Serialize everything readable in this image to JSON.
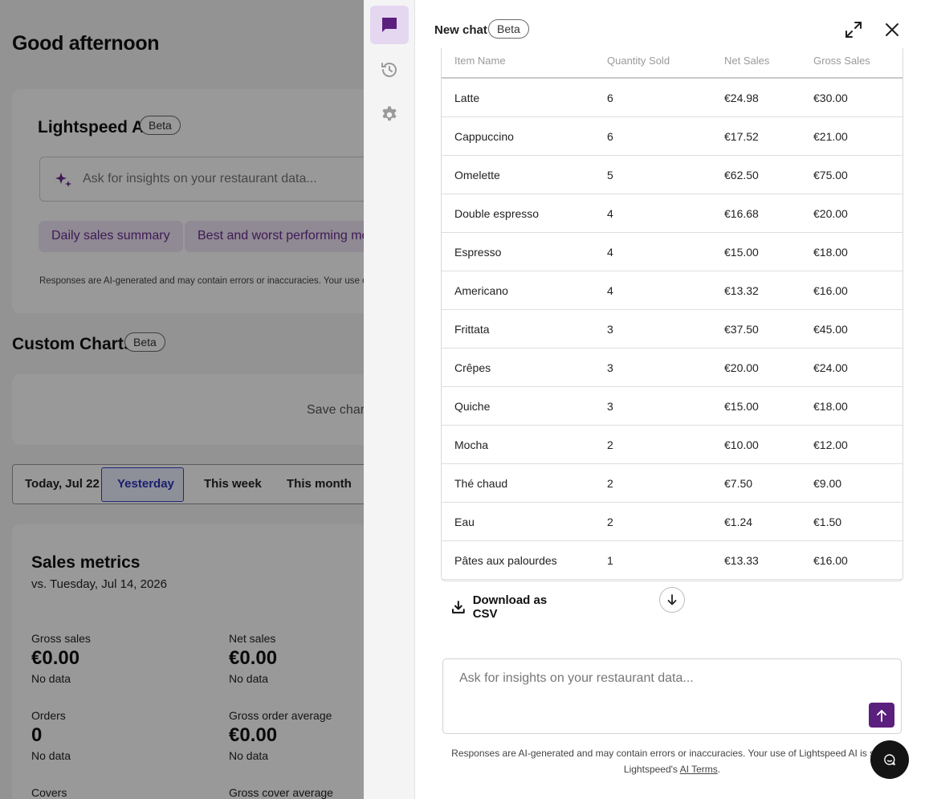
{
  "background": {
    "greeting": "Good afternoon",
    "ai_card": {
      "title": "Lightspeed AI",
      "badge": "Beta",
      "input_placeholder": "Ask for insights on your restaurant data...",
      "chips": [
        "Daily sales summary",
        "Best and worst performing me"
      ],
      "disclaimer": "Responses are AI-generated and may contain errors or inaccuracies. Your use o"
    },
    "custom_charts": {
      "title": "Custom Charts",
      "badge": "Beta",
      "save_text": "Save chart"
    },
    "period": {
      "options": [
        "Today, Jul 22",
        "Yesterday",
        "This week",
        "This month"
      ],
      "selected": "Yesterday"
    },
    "sales_metrics": {
      "title": "Sales metrics",
      "comparison": "vs. Tuesday, Jul 14, 2026",
      "metrics": [
        {
          "label": "Gross sales",
          "value": "€0.00",
          "note": "No data"
        },
        {
          "label": "Net sales",
          "value": "€0.00",
          "note": "No data"
        },
        {
          "label": "Orders",
          "value": "0",
          "note": "No data"
        },
        {
          "label": "Gross order average",
          "value": "€0.00",
          "note": "No data"
        },
        {
          "label": "Covers",
          "value": "",
          "note": ""
        },
        {
          "label": "Gross cover average",
          "value": "",
          "note": ""
        }
      ]
    }
  },
  "panel": {
    "title": "New chat",
    "badge": "Beta",
    "rail_icons": [
      "chat-icon",
      "history-icon",
      "gear-icon"
    ],
    "accent_color": "#5b1f7e",
    "table": {
      "headers": [
        "Item Name",
        "Quantity Sold",
        "Net Sales",
        "Gross Sales"
      ],
      "rows": [
        [
          "Latte",
          "6",
          "€24.98",
          "€30.00"
        ],
        [
          "Cappuccino",
          "6",
          "€17.52",
          "€21.00"
        ],
        [
          "Omelette",
          "5",
          "€62.50",
          "€75.00"
        ],
        [
          "Double espresso",
          "4",
          "€16.68",
          "€20.00"
        ],
        [
          "Espresso",
          "4",
          "€15.00",
          "€18.00"
        ],
        [
          "Americano",
          "4",
          "€13.32",
          "€16.00"
        ],
        [
          "Frittata",
          "3",
          "€37.50",
          "€45.00"
        ],
        [
          "Crêpes",
          "3",
          "€20.00",
          "€24.00"
        ],
        [
          "Quiche",
          "3",
          "€15.00",
          "€18.00"
        ],
        [
          "Mocha",
          "2",
          "€10.00",
          "€12.00"
        ],
        [
          "Thé chaud",
          "2",
          "€7.50",
          "€9.00"
        ],
        [
          "Eau",
          "2",
          "€1.24",
          "€1.50"
        ],
        [
          "Pâtes aux palourdes",
          "1",
          "€13.33",
          "€16.00"
        ]
      ]
    },
    "download_label": "Download as CSV",
    "input_placeholder": "Ask for insights on your restaurant data...",
    "disclaimer_line1": "Responses are AI-generated and may contain errors or inaccuracies. Your use of Lightspeed AI is subje",
    "disclaimer_line2_prefix": "Lightspeed's ",
    "disclaimer_link": "AI Terms",
    "disclaimer_line2_suffix": "."
  }
}
